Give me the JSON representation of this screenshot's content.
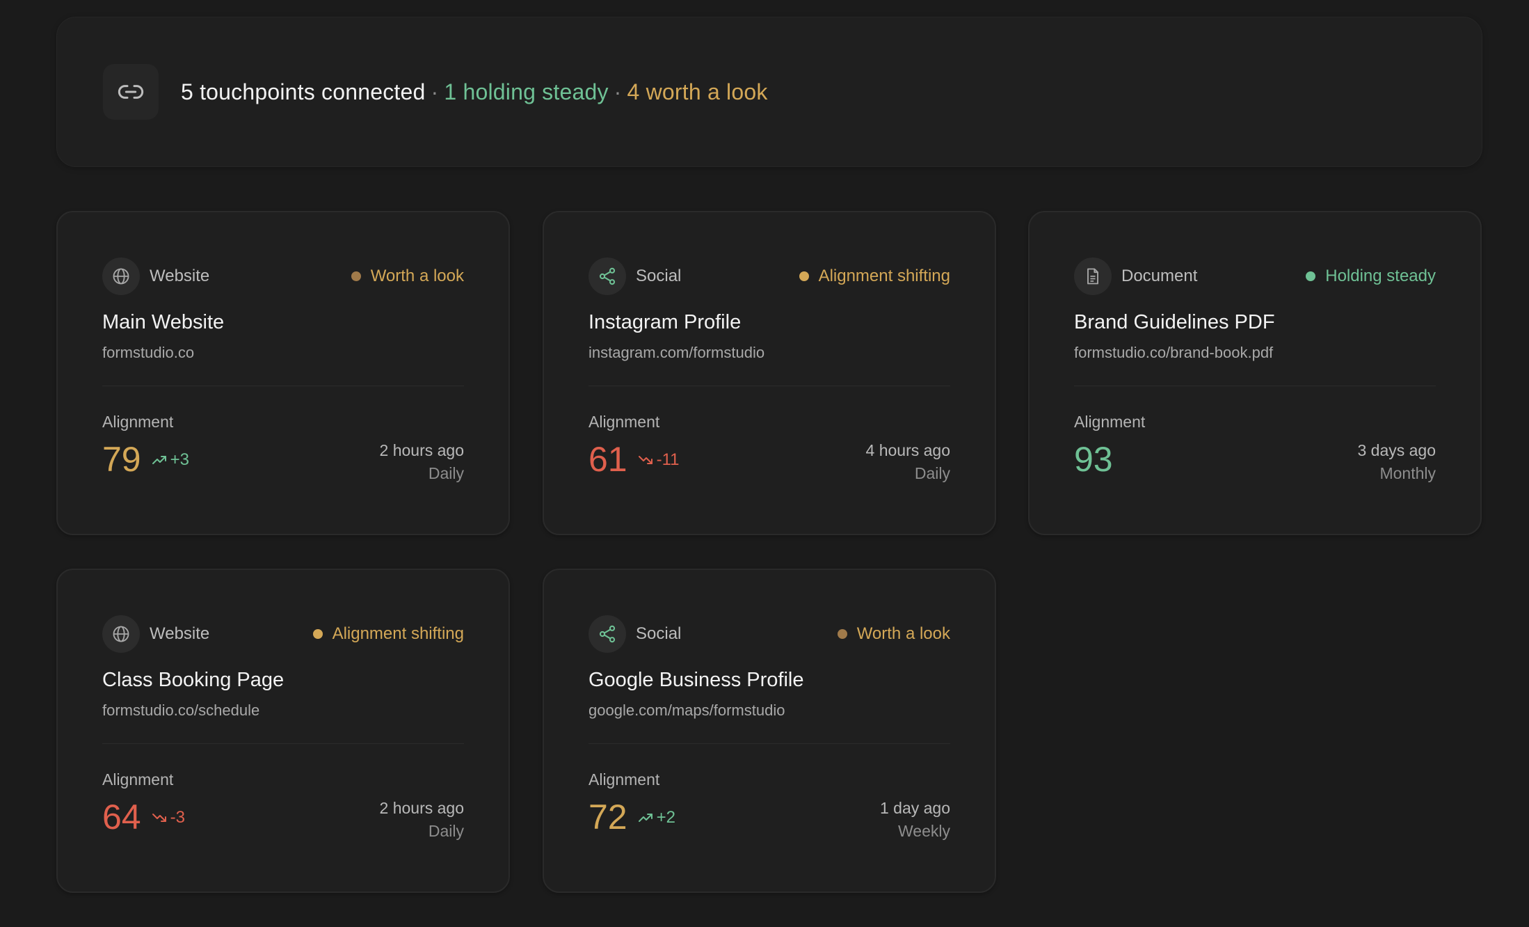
{
  "summary": {
    "main": "5 touchpoints connected",
    "sep": "·",
    "steady": "1 holding steady",
    "look": "4 worth a look",
    "icon": "link-icon"
  },
  "common": {
    "metric_label": "Alignment"
  },
  "colors": {
    "amber": "#d4a857",
    "amber_dim": "#a07a4a",
    "green": "#6fc195",
    "red": "#e0604d"
  },
  "cards": [
    {
      "type": "Website",
      "type_icon": "globe-icon",
      "status": "Worth a look",
      "title": "Main Website",
      "url": "formstudio.co",
      "score": "79",
      "delta": "+3",
      "trend": "up",
      "ago": "2 hours ago",
      "freq": "Daily"
    },
    {
      "type": "Social",
      "type_icon": "share-icon",
      "status": "Alignment shifting",
      "title": "Instagram Profile",
      "url": "instagram.com/formstudio",
      "score": "61",
      "delta": "-11",
      "trend": "down",
      "ago": "4 hours ago",
      "freq": "Daily"
    },
    {
      "type": "Document",
      "type_icon": "document-icon",
      "status": "Holding steady",
      "title": "Brand Guidelines PDF",
      "url": "formstudio.co/brand-book.pdf",
      "score": "93",
      "delta": "",
      "trend": "none",
      "ago": "3 days ago",
      "freq": "Monthly"
    },
    {
      "type": "Website",
      "type_icon": "globe-icon",
      "status": "Alignment shifting",
      "title": "Class Booking Page",
      "url": "formstudio.co/schedule",
      "score": "64",
      "delta": "-3",
      "trend": "down",
      "ago": "2 hours ago",
      "freq": "Daily"
    },
    {
      "type": "Social",
      "type_icon": "share-icon",
      "status": "Worth a look",
      "title": "Google Business Profile",
      "url": "google.com/maps/formstudio",
      "score": "72",
      "delta": "+2",
      "trend": "up",
      "ago": "1 day ago",
      "freq": "Weekly"
    }
  ]
}
